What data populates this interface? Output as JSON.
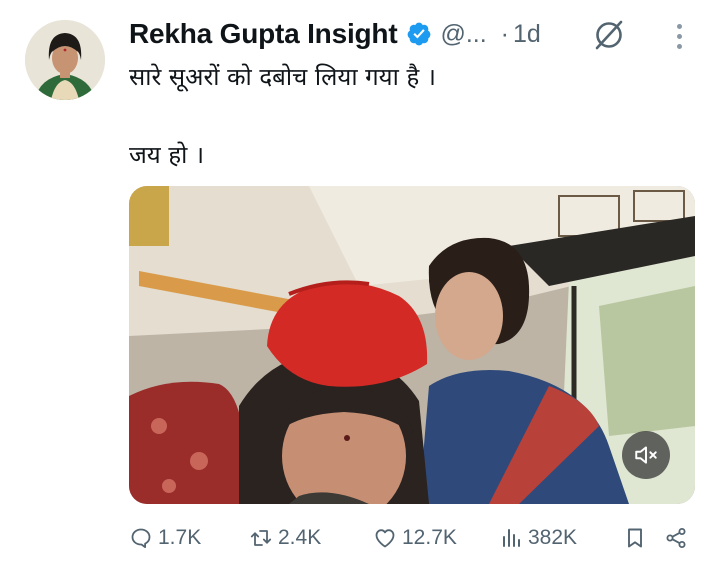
{
  "tweet": {
    "author_name": "Rekha Gupta Insight",
    "handle": "@...",
    "separator": "·",
    "time": "1d",
    "text_line1": "सारे सूअरों को दबोच लिया गया है ।",
    "text_line2": "जय हो ।"
  },
  "icons": {
    "verified": "verified-badge-icon",
    "grok": "grok-icon",
    "more": "more-icon",
    "mute": "muted-speaker-icon",
    "reply": "reply-icon",
    "retweet": "retweet-icon",
    "like": "heart-icon",
    "views": "views-icon",
    "bookmark": "bookmark-icon",
    "share": "share-icon"
  },
  "colors": {
    "verified_blue": "#1d9bf0",
    "secondary_text": "#536471",
    "primary_text": "#0f1419"
  },
  "actions": {
    "replies": "1.7K",
    "retweets": "2.4K",
    "likes": "12.7K",
    "views": "382K"
  }
}
